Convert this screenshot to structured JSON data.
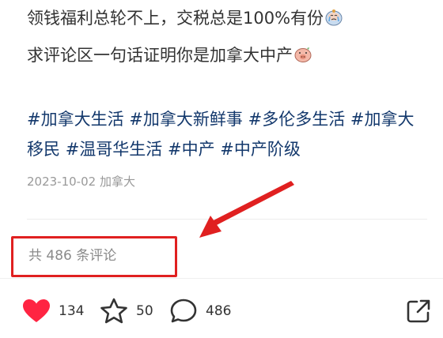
{
  "post": {
    "line1": "领钱福利总轮不上，交税总是100%有份",
    "line2": "求评论区一句话证明你是加拿大中产",
    "emoji1": "crying-face-emoji",
    "emoji2": "pig-face-emoji",
    "tags": [
      "#加拿大生活",
      "#加拿大新鲜事",
      "#多伦多生活",
      "#加拿大移民",
      "#温哥华生活",
      "#中产",
      "#中产阶级"
    ],
    "date": "2023-10-02",
    "location": "加拿大"
  },
  "comments": {
    "count_label": "共 486 条评论"
  },
  "annotation": {
    "box_color": "#e02020",
    "arrow_color": "#e02020"
  },
  "actions": {
    "like_count": "134",
    "favorite_count": "50",
    "comment_count": "486",
    "like_icon": "heart-icon",
    "favorite_icon": "star-icon",
    "comment_icon": "comment-bubble-icon",
    "share_icon": "share-icon",
    "like_color": "#ff2442"
  }
}
